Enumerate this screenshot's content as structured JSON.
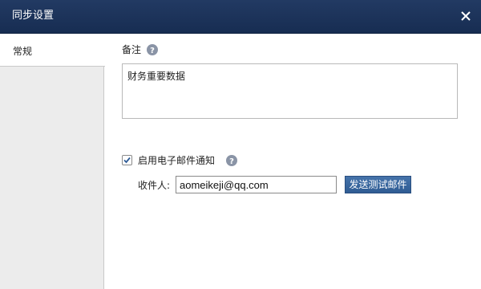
{
  "window": {
    "title": "同步设置",
    "close_icon": "close-icon"
  },
  "sidebar": {
    "items": [
      {
        "label": "常规",
        "selected": true
      }
    ]
  },
  "general": {
    "notes_label": "备注",
    "notes_value": "财务重要数据",
    "email_notify_label": "启用电子邮件通知",
    "email_notify_checked": true,
    "recipient_label": "收件人:",
    "recipient_value": "aomeikeji@qq.com",
    "send_test_label": "发送测试邮件"
  },
  "colors": {
    "titlebar": "#1b3158",
    "button": "#3a679e",
    "help_icon": "#8a94a6"
  }
}
